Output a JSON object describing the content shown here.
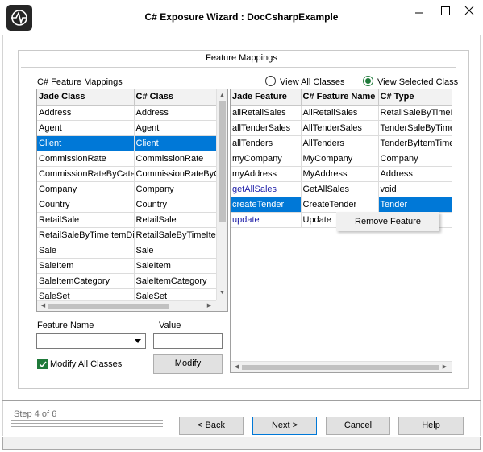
{
  "window": {
    "title": "C# Exposure Wizard : DocCsharpExample",
    "icon": "app-logo-icon",
    "controls": [
      "minimize-icon",
      "maximize-icon",
      "close-icon"
    ]
  },
  "group": {
    "title": "Feature Mappings"
  },
  "left_panel": {
    "label": "C# Feature Mappings",
    "columns": [
      "Jade Class",
      "C# Class"
    ],
    "rows": [
      [
        "Address",
        "Address"
      ],
      [
        "Agent",
        "Agent"
      ],
      [
        "Client",
        "Client"
      ],
      [
        "CommissionRate",
        "CommissionRate"
      ],
      [
        "CommissionRateByCateg",
        "CommissionRateByC"
      ],
      [
        "Company",
        "Company"
      ],
      [
        "Country",
        "Country"
      ],
      [
        "RetailSale",
        "RetailSale"
      ],
      [
        "RetailSaleByTimeItemDict",
        "RetailSaleByTimeItem"
      ],
      [
        "Sale",
        "Sale"
      ],
      [
        "SaleItem",
        "SaleItem"
      ],
      [
        "SaleItemCategory",
        "SaleItemCategory"
      ],
      [
        "SaleSet",
        "SaleSet"
      ]
    ],
    "selected_row": 2
  },
  "view_options": {
    "all_label": "View All Classes",
    "selected_label": "View Selected Class",
    "selected": "selected"
  },
  "right_panel": {
    "columns": [
      "Jade Feature",
      "C# Feature Name",
      "C# Type"
    ],
    "rows": [
      [
        "allRetailSales",
        "AllRetailSales",
        "RetailSaleByTimeIt"
      ],
      [
        "allTenderSales",
        "AllTenderSales",
        "TenderSaleByTime"
      ],
      [
        "allTenders",
        "AllTenders",
        "TenderByItemTimeC"
      ],
      [
        "myCompany",
        "MyCompany",
        "Company"
      ],
      [
        "myAddress",
        "MyAddress",
        "Address"
      ],
      [
        "getAllSales",
        "GetAllSales",
        "void"
      ],
      [
        "createTender",
        "CreateTender",
        "Tender"
      ],
      [
        "update",
        "Update",
        ""
      ]
    ]
  },
  "context_menu": {
    "item": "Remove Feature"
  },
  "form": {
    "feature_name_label": "Feature Name",
    "feature_name_value": "",
    "value_label": "Value",
    "value_value": "",
    "modify_all_label": "Modify All Classes",
    "modify_all_checked": true,
    "modify_button": "Modify"
  },
  "footer": {
    "step_text": "Step 4 of 6",
    "back_button": "< Back",
    "next_button": "Next >",
    "cancel_button": "Cancel",
    "help_button": "Help"
  },
  "colors": {
    "selection": "#0078d7",
    "accent_green": "#1f7a3a",
    "link_blue": "#1a1aa6"
  }
}
